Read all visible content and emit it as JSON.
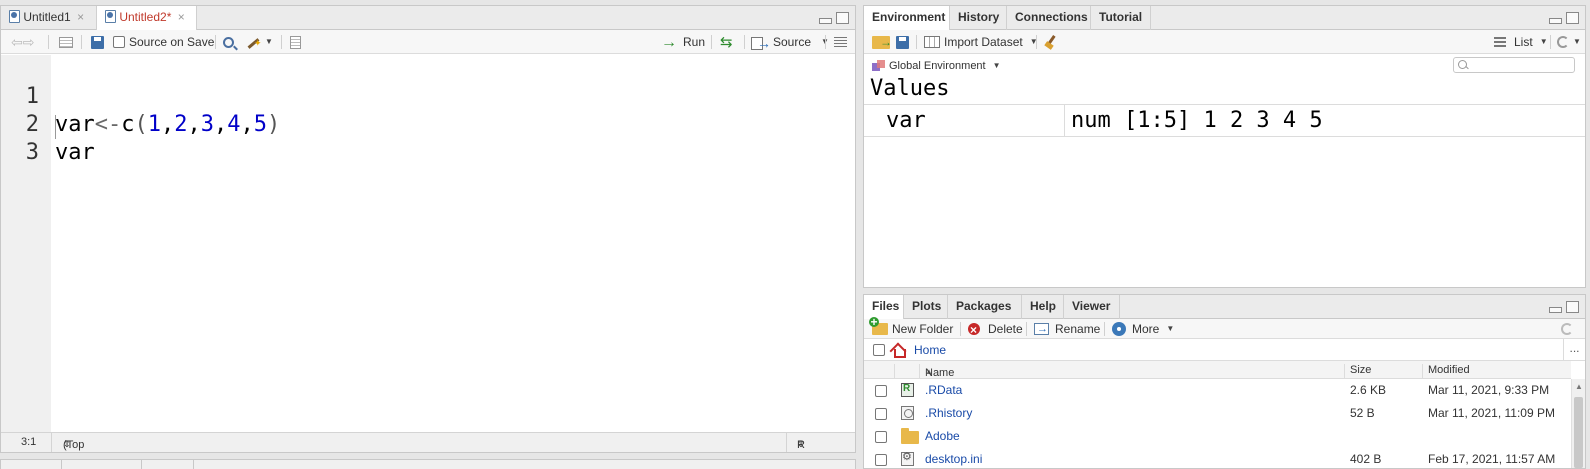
{
  "source_pane": {
    "tabs": [
      {
        "label": "Untitled1",
        "close": "×"
      },
      {
        "label": "Untitled2*",
        "close": "×"
      }
    ],
    "toolbar": {
      "source_on_save": "Source on Save",
      "run": "Run",
      "source": "Source"
    },
    "lines": [
      {
        "num": "1"
      },
      {
        "num": "2",
        "text": "var"
      },
      {
        "num": "3",
        "text": ""
      }
    ],
    "line1_tokens": [
      "var",
      "<-",
      "c",
      "(",
      "1",
      ",",
      "2",
      ",",
      "3",
      ",",
      "4",
      ",",
      "5",
      ")"
    ],
    "status": {
      "position": "3:1",
      "scope": "(Top Level)",
      "file_type": "R Script"
    }
  },
  "env_pane": {
    "tabs": [
      "Environment",
      "History",
      "Connections",
      "Tutorial"
    ],
    "toolbar": {
      "import_dataset": "Import Dataset",
      "view_mode": "List"
    },
    "environment": "Global Environment",
    "section": "Values",
    "variables": [
      {
        "name": "var",
        "value": "num [1:5] 1 2 3 4 5"
      }
    ]
  },
  "files_pane": {
    "tabs": [
      "Files",
      "Plots",
      "Packages",
      "Help",
      "Viewer"
    ],
    "toolbar": {
      "new_folder": "New Folder",
      "delete": "Delete",
      "rename": "Rename",
      "more": "More"
    },
    "breadcrumb": "Home",
    "breadcrumb_more": "...",
    "columns": {
      "name": "Name",
      "size": "Size",
      "modified": "Modified"
    },
    "sort_indicator": "▲",
    "files": [
      {
        "name": ".RData",
        "size": "2.6 KB",
        "modified": "Mar 11, 2021, 9:33 PM",
        "icon": "rdata-file-icon"
      },
      {
        "name": ".Rhistory",
        "size": "52 B",
        "modified": "Mar 11, 2021, 11:09 PM",
        "icon": "history-file-icon"
      },
      {
        "name": "Adobe",
        "size": "",
        "modified": "",
        "icon": "folder-icon"
      },
      {
        "name": "desktop.ini",
        "size": "402 B",
        "modified": "Feb 17, 2021, 11:57 AM",
        "icon": "settings-file-icon"
      }
    ]
  },
  "colors": {
    "active_tab_text": "#c0392b",
    "link": "#1a4ba8",
    "number_token": "#0000c8"
  }
}
